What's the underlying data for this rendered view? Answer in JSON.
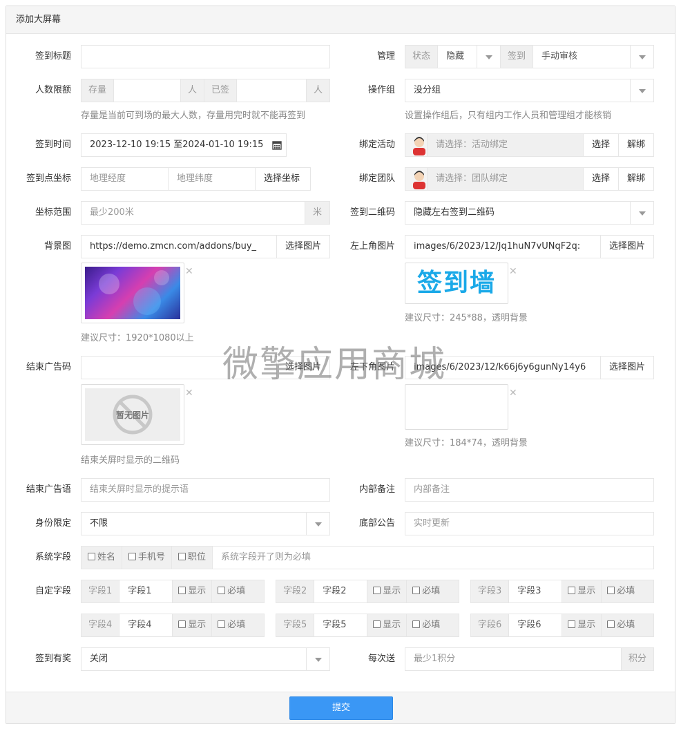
{
  "panel": {
    "title": "添加大屏幕",
    "submit_label": "提交"
  },
  "watermark": "微擎应用商城",
  "left": {
    "title": {
      "label": "签到标题",
      "value": ""
    },
    "limit": {
      "label": "人数限额",
      "stock": "存量",
      "person": "人",
      "signed": "已签",
      "help": "存量是当前可到场的最大人数，存量用完时就不能再签到"
    },
    "time": {
      "label": "签到时间",
      "value": "2023-12-10 19:15 至2024-01-10 19:15"
    },
    "coord": {
      "label": "签到点坐标",
      "lng_placeholder": "地理经度",
      "lat_placeholder": "地理纬度",
      "button": "选择坐标"
    },
    "range": {
      "label": "坐标范围",
      "placeholder": "最少200米",
      "unit": "米"
    },
    "bg": {
      "label": "背景图",
      "value": "https://demo.zmcn.com/addons/buy_",
      "button": "选择图片",
      "help": "建议尺寸：1920*1080以上"
    },
    "endqr": {
      "label": "结束广告码",
      "value": "",
      "button": "选择图片",
      "placeholder_img": "暂无图片",
      "help": "结束关屏时显示的二维码"
    },
    "endmsg": {
      "label": "结束广告语",
      "placeholder": "结束关屏时显示的提示语"
    },
    "identity": {
      "label": "身份限定",
      "value": "不限"
    },
    "sysfield": {
      "label": "系统字段",
      "opts": [
        "姓名",
        "手机号",
        "职位"
      ],
      "placeholder": "系统字段开了则为必填"
    },
    "custom": {
      "label": "自定字段",
      "show": "显示",
      "required": "必填",
      "fields": [
        {
          "name": "字段1",
          "value": "字段1"
        },
        {
          "name": "字段2",
          "value": "字段2"
        },
        {
          "name": "字段3",
          "value": "字段3"
        },
        {
          "name": "字段4",
          "value": "字段4"
        },
        {
          "name": "字段5",
          "value": "字段5"
        },
        {
          "name": "字段6",
          "value": "字段6"
        }
      ]
    },
    "reward": {
      "label": "签到有奖",
      "value": "关闭"
    }
  },
  "right": {
    "manage": {
      "label": "管理",
      "state": "状态",
      "state_value": "隐藏",
      "sign": "签到",
      "sign_value": "手动审核"
    },
    "opgroup": {
      "label": "操作组",
      "value": "没分组",
      "help": "设置操作组后，只有组内工作人员和管理组才能核销"
    },
    "activity": {
      "label": "绑定活动",
      "placeholder": "请选择：活动绑定",
      "select": "选择",
      "unbind": "解绑"
    },
    "team": {
      "label": "绑定团队",
      "placeholder": "请选择：团队绑定",
      "select": "选择",
      "unbind": "解绑"
    },
    "qrcode": {
      "label": "签到二维码",
      "value": "隐藏左右签到二维码"
    },
    "topleft": {
      "label": "左上角图片",
      "value": "images/6/2023/12/Jq1huN7vUNqF2q:",
      "button": "选择图片",
      "logo_text": "签到墙",
      "help": "建议尺寸：245*88，透明背景"
    },
    "bottomleft": {
      "label": "左下角图片",
      "value": "images/6/2023/12/k66j6y6gunNy14y6",
      "button": "选择图片",
      "help": "建议尺寸：184*74，透明背景"
    },
    "note": {
      "label": "内部备注",
      "placeholder": "内部备注"
    },
    "notice": {
      "label": "底部公告",
      "placeholder": "实时更新"
    },
    "each": {
      "label": "每次送",
      "placeholder": "最少1积分",
      "unit": "积分"
    }
  },
  "colors": {
    "primary": "#3a97f5",
    "addon_bg": "#f0f0f0",
    "logo": "#1aa9e8"
  }
}
